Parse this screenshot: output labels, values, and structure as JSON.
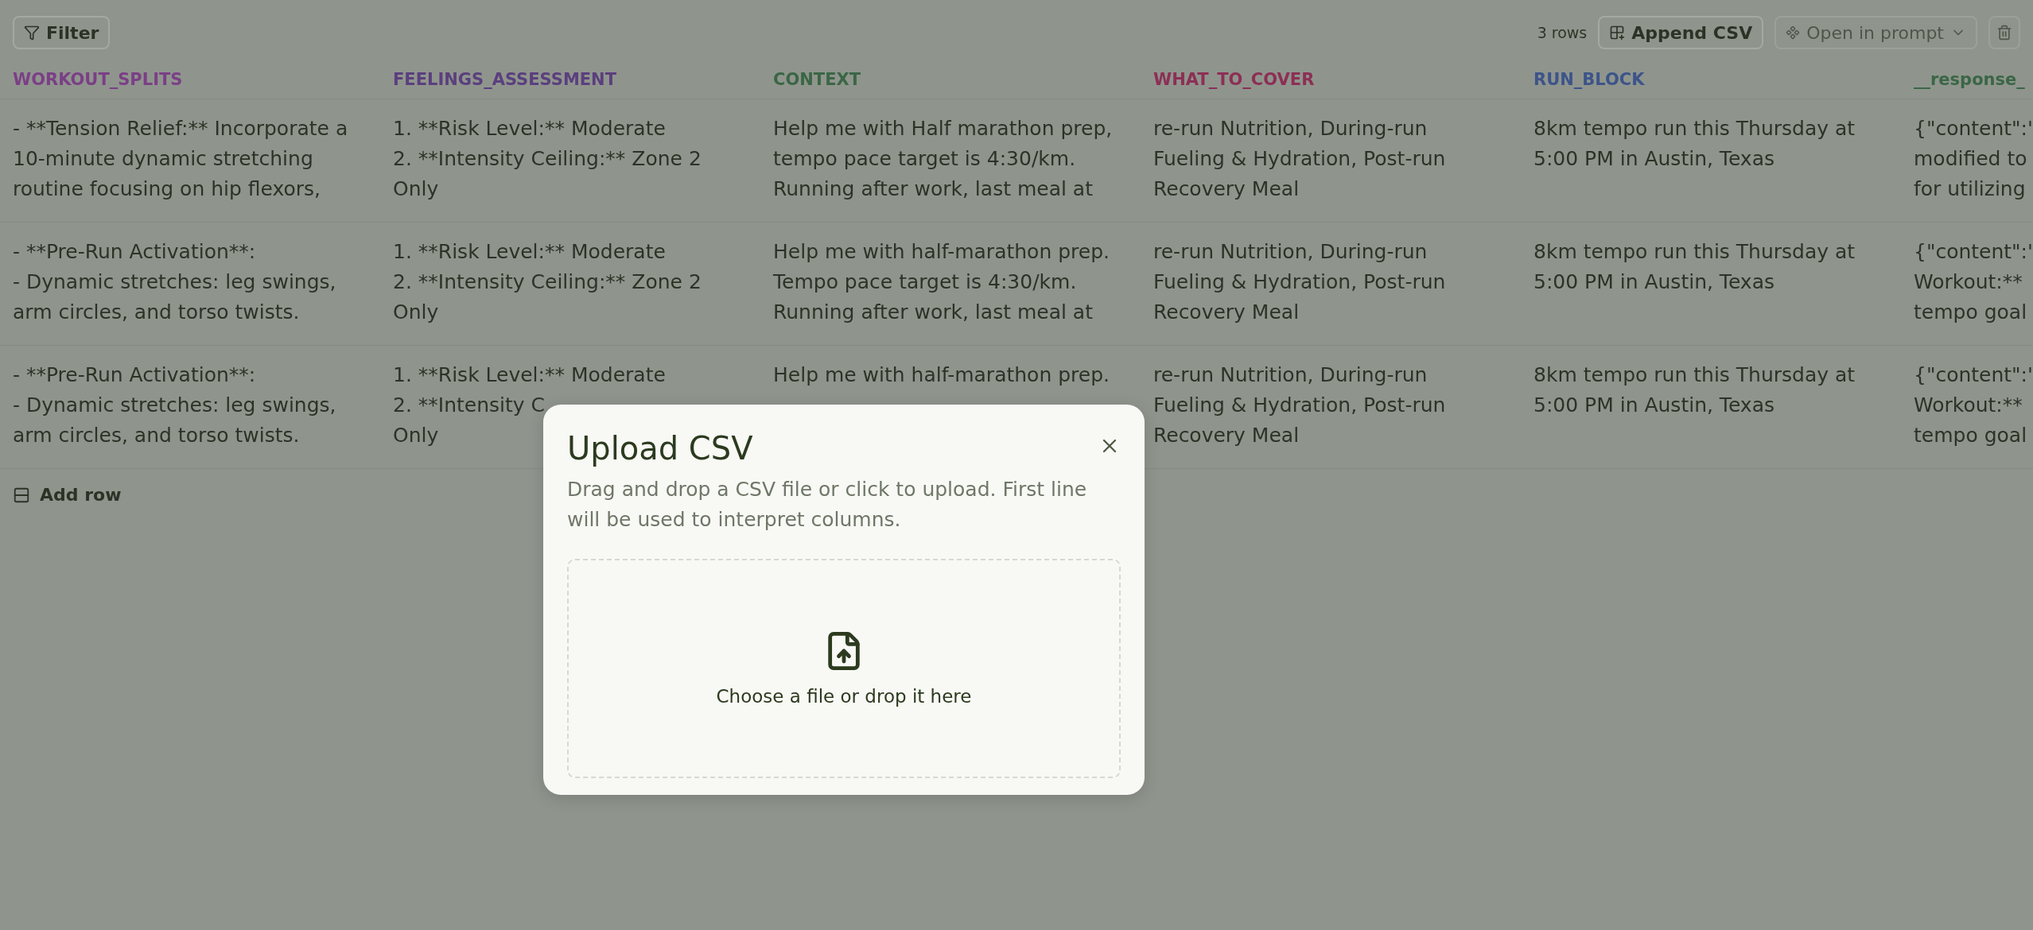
{
  "toolbar": {
    "filter": {
      "label": "Filter"
    },
    "row_count": "3 rows",
    "append": {
      "label": "Append CSV",
      "disabled": false
    },
    "open_prompt": {
      "label": "Open in prompt",
      "disabled": true
    }
  },
  "table": {
    "columns": [
      {
        "label": "WORKOUT_SPLITS",
        "color": "#7b3f86"
      },
      {
        "label": "FEELINGS_ASSESSMENT",
        "color": "#5b3f7e"
      },
      {
        "label": "CONTEXT",
        "color": "#3b6646"
      },
      {
        "label": "WHAT_TO_COVER",
        "color": "#8c2f55"
      },
      {
        "label": "RUN_BLOCK",
        "color": "#3d548a"
      },
      {
        "label": "__response_",
        "color": "#3b6646"
      }
    ],
    "rows": [
      {
        "cells": [
          [
            "- **Tension Relief:** Incorporate a",
            "10-minute dynamic stretching",
            "routine focusing on hip flexors,"
          ],
          [
            "1. **Risk Level:** Moderate",
            "2. **Intensity Ceiling:** Zone 2",
            "Only"
          ],
          [
            "Help me with Half marathon prep,",
            "tempo pace target is 4:30/km.",
            "Running after work, last meal at"
          ],
          [
            "re-run Nutrition, During-run",
            "Fueling & Hydration, Post-run",
            "Recovery Meal"
          ],
          [
            "8km tempo run this Thursday at",
            "5:00 PM in Austin, Texas"
          ],
          [
            "{\"content\":\"",
            "modified to",
            "for utilizing"
          ]
        ]
      },
      {
        "cells": [
          [
            "- **Pre-Run Activation**:",
            "- Dynamic stretches: leg swings,",
            "arm circles, and torso twists."
          ],
          [
            "1. **Risk Level:** Moderate",
            "2. **Intensity Ceiling:** Zone 2",
            "Only"
          ],
          [
            "Help me with half-marathon prep.",
            "Tempo pace target is 4:30/km.",
            "Running after work, last meal at"
          ],
          [
            "re-run Nutrition, During-run",
            "Fueling & Hydration, Post-run",
            "Recovery Meal"
          ],
          [
            "8km tempo run this Thursday at",
            "5:00 PM in Austin, Texas"
          ],
          [
            "{\"content\":\"",
            "Workout:**",
            "tempo goal"
          ]
        ]
      },
      {
        "cells": [
          [
            "- **Pre-Run Activation**:",
            "- Dynamic stretches: leg swings,",
            "arm circles, and torso twists."
          ],
          [
            "1. **Risk Level:** Moderate",
            "2. **Intensity C",
            "Only"
          ],
          [
            "Help me with half-marathon prep."
          ],
          [
            "re-run Nutrition, During-run",
            "Fueling & Hydration, Post-run",
            "Recovery Meal"
          ],
          [
            "8km tempo run this Thursday at",
            "5:00 PM in Austin, Texas"
          ],
          [
            "{\"content\":\"",
            "Workout:**",
            "tempo goal"
          ]
        ]
      }
    ],
    "add_row": "Add row"
  },
  "dialog": {
    "title": "Upload CSV",
    "description": "Drag and drop a CSV file or click to upload. First line will be used to interpret columns.",
    "dropzone": {
      "label": "Choose a file or drop it here"
    }
  }
}
